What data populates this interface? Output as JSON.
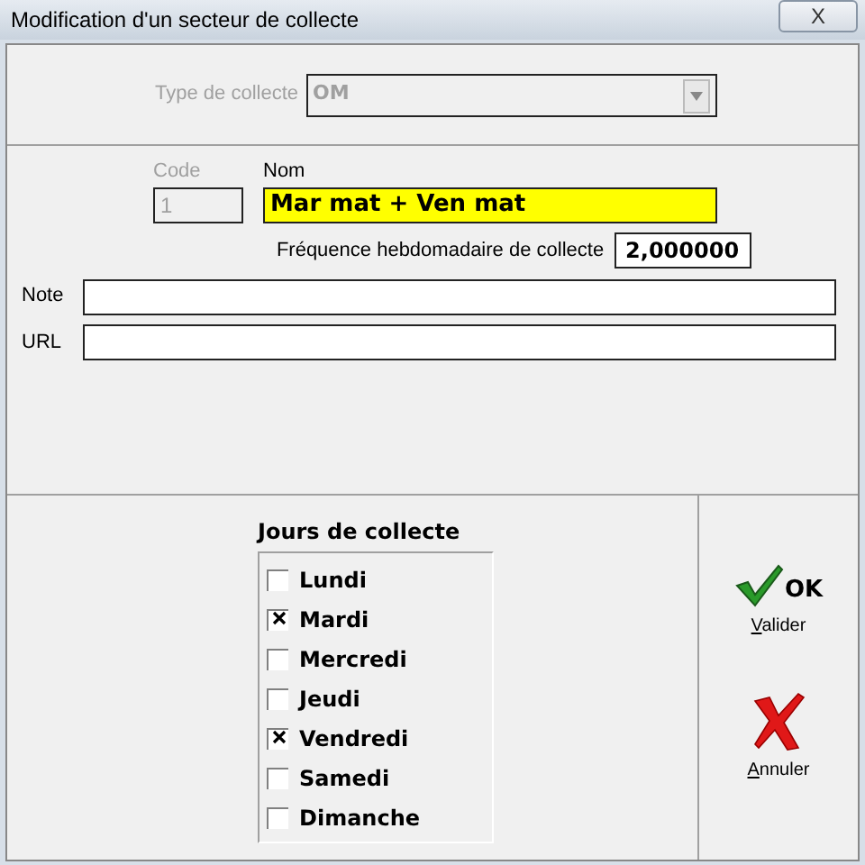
{
  "window": {
    "title": "Modification d'un secteur de collecte",
    "close": "X"
  },
  "type_collecte": {
    "label": "Type de collecte",
    "value": "OM",
    "disabled": true
  },
  "code": {
    "label": "Code",
    "value": "1",
    "disabled": true
  },
  "nom": {
    "label": "Nom",
    "value": "Mar mat + Ven mat"
  },
  "frequence": {
    "label": "Fréquence hebdomadaire de collecte",
    "value": "2,000000"
  },
  "note": {
    "label": "Note"
  },
  "url": {
    "label": "URL"
  },
  "jours": {
    "title": "Jours de collecte",
    "items": [
      {
        "label": "Lundi",
        "checked": false
      },
      {
        "label": "Mardi",
        "checked": true
      },
      {
        "label": "Mercredi",
        "checked": false
      },
      {
        "label": "Jeudi",
        "checked": false
      },
      {
        "label": "Vendredi",
        "checked": true
      },
      {
        "label": "Samedi",
        "checked": false
      },
      {
        "label": "Dimanche",
        "checked": false
      }
    ]
  },
  "buttons": [
    {
      "kind": "ok",
      "badge": "OK",
      "label": "Valider"
    },
    {
      "kind": "cancel",
      "label": "Annuler"
    }
  ]
}
